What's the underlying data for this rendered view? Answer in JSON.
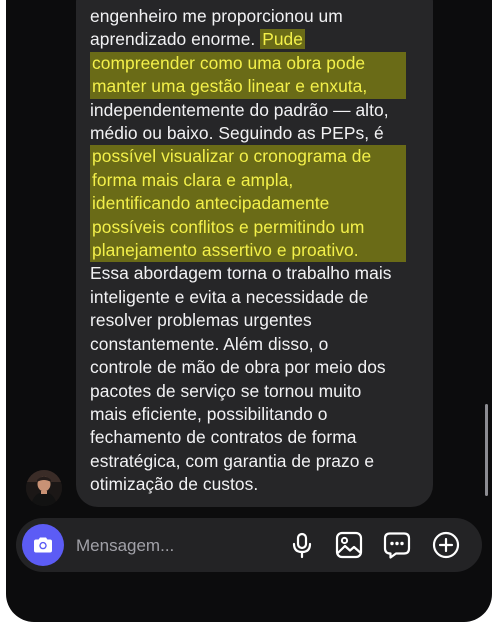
{
  "message": {
    "lines": [
      {
        "before": "engenheiro me proporcionou um",
        "highlight": "",
        "after": ""
      },
      {
        "before": "aprendizado enorme. ",
        "highlight": "Pude",
        "after": ""
      },
      {
        "before": "",
        "highlight": "compreender como uma obra pode",
        "after": ""
      },
      {
        "before": "",
        "highlight": "manter uma gestão linear e enxuta,",
        "after": ""
      },
      {
        "before": "independentemente do padrão — alto,",
        "highlight": "",
        "after": ""
      },
      {
        "before": "médio ou baixo. Seguindo as PEPs, é",
        "highlight": "",
        "after": ""
      },
      {
        "before": "",
        "highlight": "possível visualizar o cronograma de",
        "after": ""
      },
      {
        "before": "",
        "highlight": "forma mais clara e ampla,",
        "after": ""
      },
      {
        "before": "",
        "highlight": "identificando antecipadamente",
        "after": ""
      },
      {
        "before": "",
        "highlight": "possíveis conflitos e permitindo um",
        "after": ""
      },
      {
        "before": "",
        "highlight": "planejamento assertivo e proativo.",
        "after": ""
      },
      {
        "before": "Essa abordagem torna o trabalho mais",
        "highlight": "",
        "after": ""
      },
      {
        "before": "inteligente e evita a necessidade de",
        "highlight": "",
        "after": ""
      },
      {
        "before": "resolver problemas urgentes",
        "highlight": "",
        "after": ""
      },
      {
        "before": "constantemente. Além disso, o",
        "highlight": "",
        "after": ""
      },
      {
        "before": "controle de mão de obra por meio dos",
        "highlight": "",
        "after": ""
      },
      {
        "before": "pacotes de serviço se tornou muito",
        "highlight": "",
        "after": ""
      },
      {
        "before": "mais eficiente, possibilitando o",
        "highlight": "",
        "after": ""
      },
      {
        "before": "fechamento de contratos de forma",
        "highlight": "",
        "after": ""
      },
      {
        "before": "estratégica, com garantia de prazo e",
        "highlight": "",
        "after": ""
      },
      {
        "before": "otimização de custos.",
        "highlight": "",
        "after": ""
      }
    ]
  },
  "composer": {
    "placeholder": "Mensagem..."
  },
  "icons": {
    "camera": "camera-icon",
    "microphone": "microphone-icon",
    "gallery": "gallery-icon",
    "sticker": "chat-sticker-icon",
    "add": "plus-circle-icon"
  },
  "colors": {
    "background": "#0c0c0d",
    "bubble": "#262628",
    "highlight_bg": "#6a6b17",
    "highlight_text": "#f3f04a",
    "camera_button": "#5c5cf5"
  }
}
